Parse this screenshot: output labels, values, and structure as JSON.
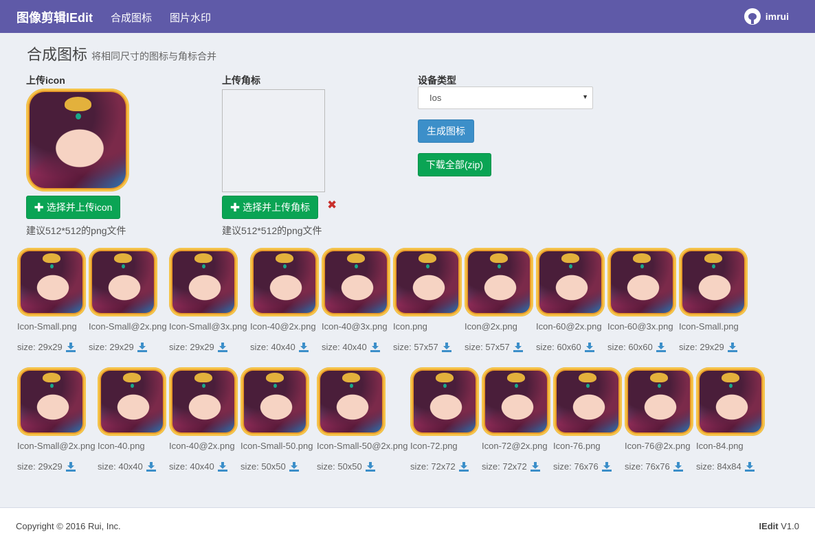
{
  "nav": {
    "brand": "图像剪辑IEdit",
    "links": [
      "合成图标",
      "图片水印"
    ],
    "user": "imrui"
  },
  "header": {
    "title": "合成图标",
    "subtitle": "将相同尺寸的图标与角标合并"
  },
  "upload_icon": {
    "label": "上传icon",
    "button": "选择并上传icon",
    "hint": "建议512*512的png文件"
  },
  "upload_badge": {
    "label": "上传角标",
    "button": "选择并上传角标",
    "hint": "建议512*512的png文件",
    "remove_icon": "✖"
  },
  "device": {
    "label": "设备类型",
    "selected": "Ios",
    "generate_button": "生成图标",
    "download_button": "下载全部(zip)"
  },
  "results": [
    {
      "name": "Icon-Small.png",
      "size": "size: 29x29"
    },
    {
      "name": "Icon-Small@2x.png",
      "size": "size: 29x29"
    },
    {
      "name": "Icon-Small@3x.png",
      "size": "size: 29x29"
    },
    {
      "name": "Icon-40@2x.png",
      "size": "size: 40x40"
    },
    {
      "name": "Icon-40@3x.png",
      "size": "size: 40x40"
    },
    {
      "name": "Icon.png",
      "size": "size: 57x57"
    },
    {
      "name": "Icon@2x.png",
      "size": "size: 57x57"
    },
    {
      "name": "Icon-60@2x.png",
      "size": "size: 60x60"
    },
    {
      "name": "Icon-60@3x.png",
      "size": "size: 60x60"
    },
    {
      "name": "Icon-Small.png",
      "size": "size: 29x29"
    },
    {
      "name": "Icon-Small@2x.png",
      "size": "size: 29x29"
    },
    {
      "name": "Icon-40.png",
      "size": "size: 40x40"
    },
    {
      "name": "Icon-40@2x.png",
      "size": "size: 40x40"
    },
    {
      "name": "Icon-Small-50.png",
      "size": "size: 50x50"
    },
    {
      "name": "Icon-Small-50@2x.png",
      "size": "size: 50x50"
    },
    {
      "name": "Icon-72.png",
      "size": "size: 72x72"
    },
    {
      "name": "Icon-72@2x.png",
      "size": "size: 72x72"
    },
    {
      "name": "Icon-76.png",
      "size": "size: 76x76"
    },
    {
      "name": "Icon-76@2x.png",
      "size": "size: 76x76"
    },
    {
      "name": "Icon-84.png",
      "size": "size: 84x84"
    }
  ],
  "footer": {
    "copyright": "Copyright © 2016 Rui, Inc.",
    "product": "IEdit",
    "version": "V1.0"
  }
}
